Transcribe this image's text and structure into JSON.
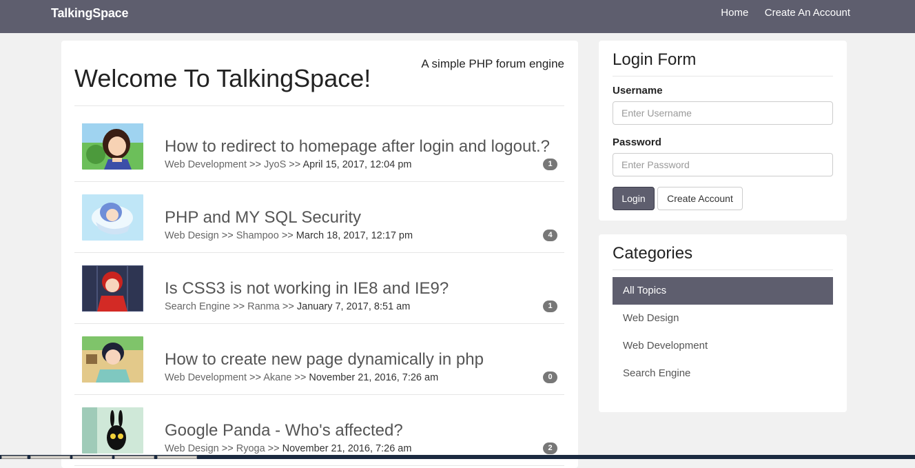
{
  "navbar": {
    "brand": "TalkingSpace",
    "links": [
      "Home",
      "Create An Account"
    ]
  },
  "main": {
    "title": "Welcome To TalkingSpace!",
    "tagline": "A simple PHP forum engine",
    "topics": [
      {
        "title": "How to redirect to homepage after login and logout.?",
        "category": "Web Development",
        "author": "JyoS",
        "date": "April 15, 2017, 12:04 pm",
        "replies": "1"
      },
      {
        "title": "PHP and MY SQL Security",
        "category": "Web Design",
        "author": "Shampoo",
        "date": "March 18, 2017, 12:17 pm",
        "replies": "4"
      },
      {
        "title": "Is CSS3 is not working in IE8 and IE9?",
        "category": "Search Engine",
        "author": "Ranma",
        "date": "January 7, 2017, 8:51 am",
        "replies": "1"
      },
      {
        "title": "How to create new page dynamically in php",
        "category": "Web Development",
        "author": "Akane",
        "date": "November 21, 2016, 7:26 am",
        "replies": "0"
      },
      {
        "title": "Google Panda - Who's affected?",
        "category": "Web Design",
        "author": "Ryoga",
        "date": "November 21, 2016, 7:26 am",
        "replies": "2"
      }
    ]
  },
  "login": {
    "title": "Login Form",
    "username_label": "Username",
    "username_placeholder": "Enter Username",
    "password_label": "Password",
    "password_placeholder": "Enter Password",
    "login_button": "Login",
    "create_button": "Create Account"
  },
  "categories": {
    "title": "Categories",
    "items": [
      "All Topics",
      "Web Design",
      "Web Development",
      "Search Engine"
    ],
    "active": "All Topics"
  },
  "colors": {
    "navbar": "#5e5e6e",
    "accent": "#5e5e6e",
    "badge": "#777777",
    "background": "#f1f1f1"
  }
}
